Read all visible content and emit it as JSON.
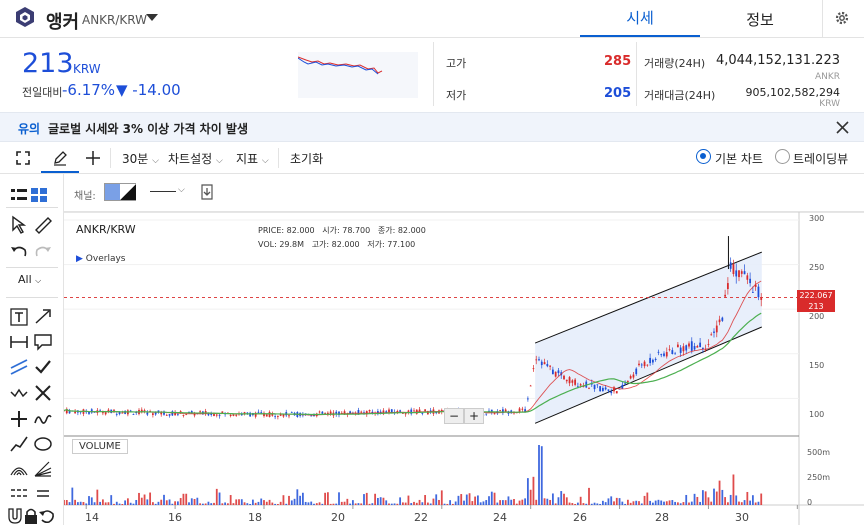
{
  "header": {
    "coin_name": "앵커",
    "pair": "ANKR/KRW",
    "tabs": [
      {
        "label": "시세",
        "active": true
      },
      {
        "label": "정보",
        "active": false
      }
    ]
  },
  "price": {
    "current": "213",
    "unit": "KRW",
    "prev_label": "전일대비",
    "change_pct": "-6.17%",
    "change_abs": "▼ -14.00"
  },
  "stats": {
    "high_label": "고가",
    "high_value": "285",
    "low_label": "저가",
    "low_value": "205",
    "volume_label": "거래량(24H)",
    "volume_value": "4,044,152,131.223",
    "volume_unit": "ANKR",
    "amount_label": "거래대금(24H)",
    "amount_value": "905,102,582,294",
    "amount_unit": "KRW"
  },
  "alert": {
    "tag": "유의",
    "message": "글로벌 시세와 3% 이상 가격 차이 발생"
  },
  "toolbar": {
    "interval": "30분",
    "chart_settings": "차트설정",
    "indicators": "지표",
    "reset": "초기화",
    "view_basic": "기본 차트",
    "view_tradingview": "트레이딩뷰",
    "selected_view": "basic"
  },
  "drawing_toolbar": {
    "fill_label": "채널:",
    "all_label": "All"
  },
  "chart": {
    "symbol": "ANKR/KRW",
    "overlays_label": "Overlays",
    "info": {
      "price_label": "PRICE:",
      "price": "82.000",
      "open_label": "시가:",
      "open": "78.700",
      "close_label": "종가:",
      "close": "82.000",
      "vol_label": "VOL:",
      "vol": "29.8M",
      "high_label": "고가:",
      "high": "82.000",
      "low_label": "저가:",
      "low": "77.100"
    },
    "volume_label": "VOLUME",
    "price_marker_1": "222.067",
    "price_marker_2": "213",
    "y_ticks": [
      "300",
      "250",
      "200",
      "150",
      "100"
    ],
    "vol_ticks": [
      "500m",
      "250m",
      "0"
    ],
    "x_ticks": [
      "14",
      "16",
      "18",
      "20",
      "22",
      "24",
      "26",
      "28",
      "30"
    ],
    "zoom_minus": "−",
    "zoom_plus": "+"
  },
  "colors": {
    "accent": "#0a5fd0",
    "down": "#1d4ed8",
    "up": "#d92b2b",
    "ma": "#4caf50",
    "channel_fill": "#e6edfb"
  },
  "chart_data": {
    "type": "line",
    "series": [
      {
        "x": [
          13.5,
          14,
          15,
          16,
          17,
          18,
          19,
          20,
          21,
          22,
          23,
          23.9,
          24.1,
          24.5,
          25,
          25.5,
          26,
          26.5,
          27,
          27.5,
          28,
          28.3,
          28.5,
          28.8,
          29.2
        ],
        "values": [
          86,
          85,
          85,
          83,
          83,
          82,
          82,
          84,
          85,
          85,
          84,
          87,
          148,
          130,
          118,
          112,
          108,
          138,
          150,
          158,
          160,
          190,
          248,
          238,
          213
        ]
      }
    ],
    "ylim": [
      60,
      300
    ],
    "xlim": [
      13.5,
      31.5
    ]
  }
}
